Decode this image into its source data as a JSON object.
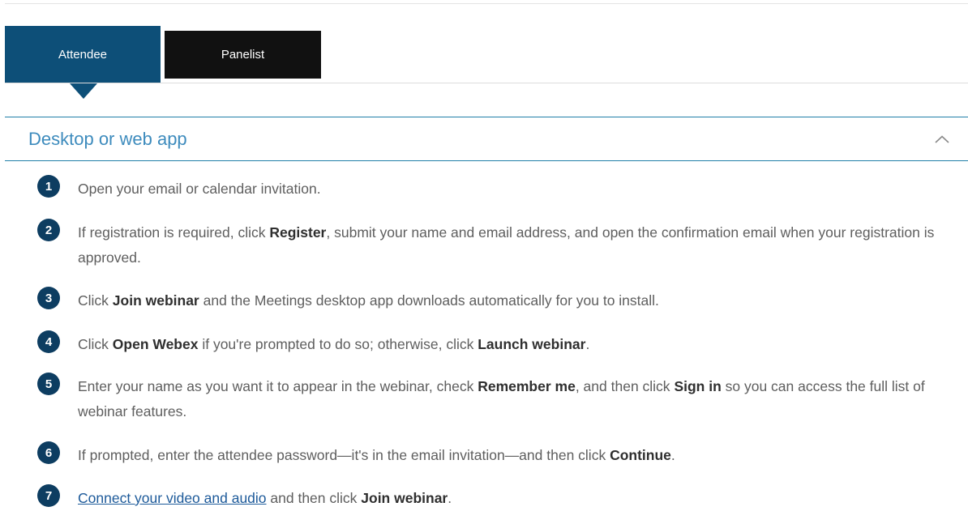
{
  "tabs": [
    {
      "label": "Attendee",
      "active": true
    },
    {
      "label": "Panelist",
      "active": false
    }
  ],
  "accordion": {
    "title": "Desktop or web app",
    "toggle_icon": "chevron-up-icon",
    "expanded": true
  },
  "steps": [
    {
      "num": "1",
      "parts": [
        "Open your email or calendar invitation."
      ]
    },
    {
      "num": "2",
      "parts": [
        "If registration is required, click ",
        "Register",
        ", submit your name and email address, and open the confirmation email when your registration is approved."
      ]
    },
    {
      "num": "3",
      "parts": [
        "Click ",
        "Join webinar",
        " and the Meetings desktop app downloads automatically for you to install."
      ]
    },
    {
      "num": "4",
      "parts": [
        "Click ",
        "Open Webex",
        " if you're prompted to do so; otherwise, click ",
        "Launch webinar",
        "."
      ]
    },
    {
      "num": "5",
      "parts": [
        "Enter your name as you want it to appear in the webinar, check ",
        "Remember me",
        ", and then click ",
        "Sign in",
        " so you can access the full list of webinar features."
      ]
    },
    {
      "num": "6",
      "parts": [
        "If prompted, enter the attendee password—it's in the email invitation—and then click ",
        "Continue",
        "."
      ]
    },
    {
      "num": "7",
      "link": "Connect your video and audio",
      "parts": [
        " and then click ",
        "Join webinar",
        "."
      ]
    }
  ],
  "colors": {
    "tab_active": "#0d4f78",
    "tab_inactive": "#111111",
    "accent": "#1f7ea8",
    "step_badge": "#0d3d61",
    "link": "#1d5a9a"
  }
}
